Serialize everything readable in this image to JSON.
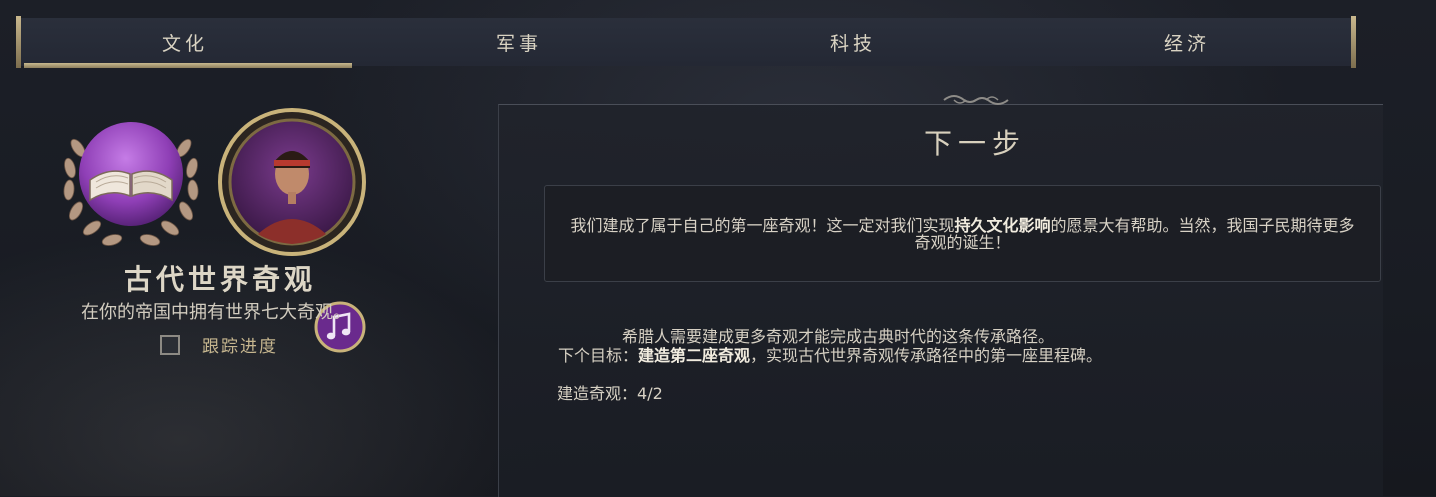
{
  "tabs": [
    "文化",
    "军事",
    "科技",
    "经济"
  ],
  "active_tab": "文化",
  "legacy": {
    "title": "古代世界奇观",
    "description": "在你的帝国中拥有世界七大奇观。",
    "track_label": "跟踪进度",
    "track_checked": false
  },
  "next_step": {
    "title": "下一步",
    "quote_pre": "我们建成了属于自己的第一座奇观！这一定对我们实现",
    "quote_bold": "持久文化影响",
    "quote_post": "的愿景大有帮助。当然，我国子民期待更多奇观的诞生！",
    "info_line1": "希腊人需要建成更多奇观才能完成古典时代的这条传承路径。",
    "goal_prefix": "下个目标：",
    "goal_bold": "建造第二座奇观",
    "goal_suffix": "，实现古代世界奇观传承路径中的第一座里程碑。",
    "counter_label": "建造奇观：",
    "counter_value": "4/2"
  },
  "icons": {
    "medal": "open-book-icon",
    "portrait": "leader-portrait",
    "badge": "music-note-icon"
  },
  "colors": {
    "gold": "#c8b98f",
    "purple": "#8f3fb6",
    "background": "#1a1d24"
  }
}
